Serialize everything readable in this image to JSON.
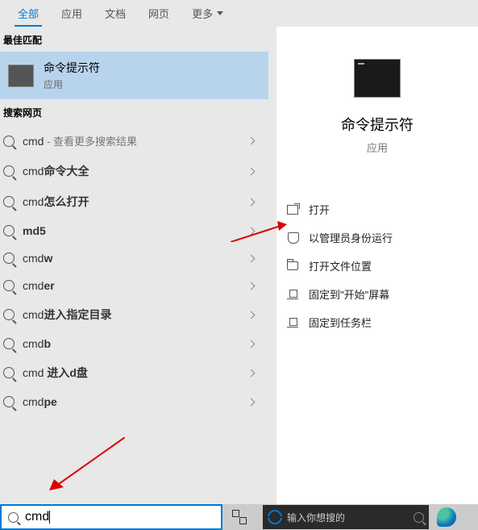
{
  "tabs": {
    "items": [
      "全部",
      "应用",
      "文档",
      "网页",
      "更多"
    ]
  },
  "sections": {
    "best_match": "最佳匹配",
    "web_search": "搜索网页"
  },
  "best_match": {
    "title": "命令提示符",
    "subtitle": "应用"
  },
  "web_results": [
    {
      "prefix": "cmd",
      "bold": "",
      "suffix": " - 查看更多搜索结果",
      "suffix_class": "web-sub"
    },
    {
      "prefix": "cmd",
      "bold": "命令大全",
      "suffix": ""
    },
    {
      "prefix": "cmd",
      "bold": "怎么打开",
      "suffix": ""
    },
    {
      "prefix": "",
      "bold": "md5",
      "suffix": ""
    },
    {
      "prefix": "cmd",
      "bold": "w",
      "suffix": ""
    },
    {
      "prefix": "cmd",
      "bold": "er",
      "suffix": ""
    },
    {
      "prefix": "cmd",
      "bold": "进入指定目录",
      "suffix": ""
    },
    {
      "prefix": "cmd",
      "bold": "b",
      "suffix": ""
    },
    {
      "prefix": "cmd ",
      "bold": "进入d盘",
      "suffix": ""
    },
    {
      "prefix": "cmd",
      "bold": "pe",
      "suffix": ""
    }
  ],
  "preview": {
    "title": "命令提示符",
    "subtitle": "应用"
  },
  "actions": [
    {
      "icon": "open",
      "label": "打开"
    },
    {
      "icon": "admin",
      "label": "以管理员身份运行"
    },
    {
      "icon": "folder",
      "label": "打开文件位置"
    },
    {
      "icon": "pin",
      "label": "固定到\"开始\"屏幕"
    },
    {
      "icon": "pin",
      "label": "固定到任务栏"
    }
  ],
  "search": {
    "value": "cmd"
  },
  "cortana": {
    "placeholder": "输入你想搜的"
  }
}
